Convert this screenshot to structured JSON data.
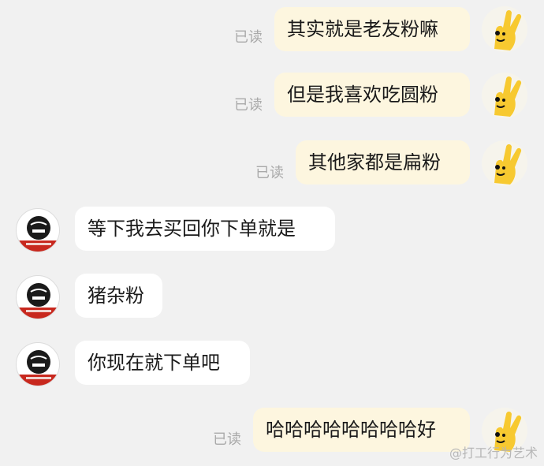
{
  "chat": {
    "read_label": "已读",
    "messages": [
      {
        "side": "out",
        "text": "其实就是老友粉嘛"
      },
      {
        "side": "out",
        "text": "但是我喜欢吃圆粉"
      },
      {
        "side": "out",
        "text": "其他家都是扁粉"
      },
      {
        "side": "in",
        "text": "等下我去买回你下单就是"
      },
      {
        "side": "in",
        "text": "猪杂粉"
      },
      {
        "side": "in",
        "text": "你现在就下单吧"
      },
      {
        "side": "out",
        "text": "哈哈哈哈哈哈哈哈好"
      }
    ]
  },
  "watermark": "@打工行为艺术",
  "colors": {
    "background": "#f1f1f1",
    "outgoing_bubble": "#fdf6df",
    "incoming_bubble": "#ffffff",
    "read_text": "#a9a9a9",
    "avatar_yellow": "#f7c930",
    "shop_avatar_red": "#c8281e"
  }
}
